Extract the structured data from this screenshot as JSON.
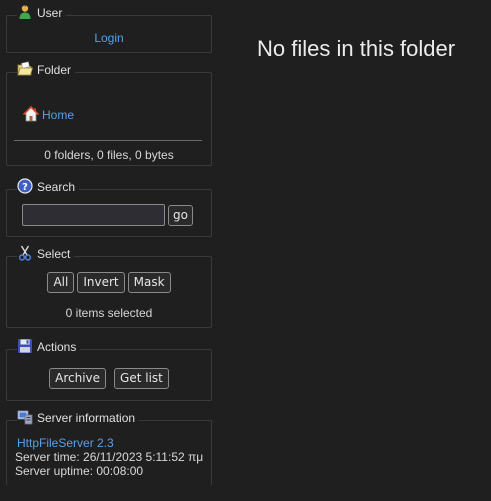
{
  "user": {
    "title": "User",
    "login_link": "Login"
  },
  "folder": {
    "title": "Folder",
    "home_link": "Home",
    "stats": "0 folders, 0 files, 0 bytes"
  },
  "search": {
    "title": "Search",
    "input_value": "",
    "go_label": "go"
  },
  "select": {
    "title": "Select",
    "all_label": "All",
    "invert_label": "Invert",
    "mask_label": "Mask",
    "status": "0 items selected"
  },
  "actions": {
    "title": "Actions",
    "archive_label": "Archive",
    "getlist_label": "Get list"
  },
  "server": {
    "title": "Server information",
    "version_link": "HttpFileServer 2.3",
    "time": "Server time: 26/11/2023 5:11:52 πμ",
    "uptime": "Server uptime: 00:08:00"
  },
  "main": {
    "message": "No files in this folder"
  },
  "colors": {
    "background": "#1f1f1f",
    "link": "#5aa0e6",
    "text": "#d8d8d8",
    "border": "#3a3a3a"
  },
  "icons": [
    "user-icon",
    "folder-icon",
    "home-icon",
    "search-icon",
    "scissors-icon",
    "save-icon",
    "server-icon"
  ]
}
